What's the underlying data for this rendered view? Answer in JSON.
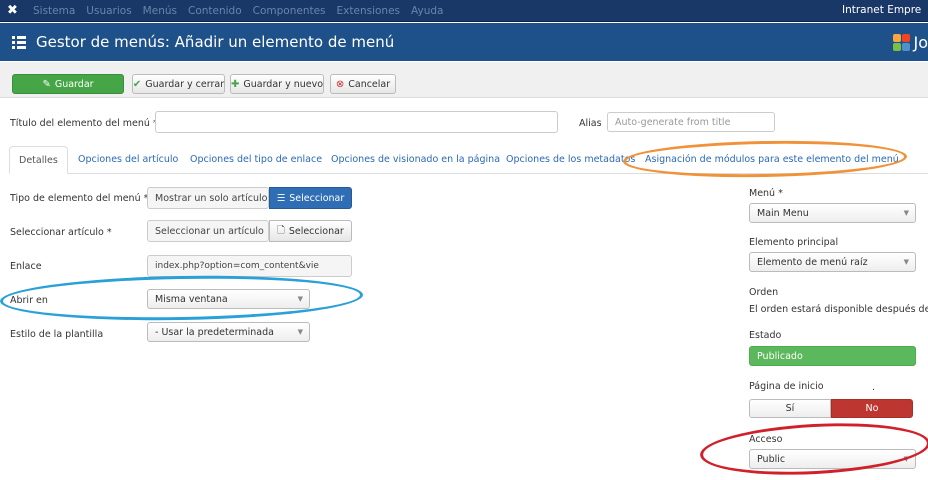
{
  "topnav": {
    "logo_icon": "joomla-x-icon",
    "items": [
      "Sistema",
      "Usuarios",
      "Menús",
      "Contenido",
      "Componentes",
      "Extensiones",
      "Ayuda"
    ],
    "site_name": "Intranet Empre"
  },
  "header": {
    "title": "Gestor de menús: Añadir un elemento de menú",
    "logo_text": "Jo"
  },
  "toolbar": {
    "save": "Guardar",
    "save_close": "Guardar y cerrar",
    "save_new": "Guardar y nuevo",
    "cancel": "Cancelar"
  },
  "title_row": {
    "label": "Título del elemento del menú *",
    "value": "",
    "alias_label": "Alias",
    "alias_placeholder": "Auto-generate from title"
  },
  "tabs": [
    {
      "label": "Detalles",
      "active": true
    },
    {
      "label": "Opciones del artículo"
    },
    {
      "label": "Opciones del tipo de enlace"
    },
    {
      "label": "Opciones de visionado en la página"
    },
    {
      "label": "Opciones de los metadatos"
    },
    {
      "label": "Asignación de módulos para este elemento del menú"
    }
  ],
  "details": {
    "type_label": "Tipo de elemento del menú *",
    "type_value": "Mostrar un solo artículo",
    "type_button": "Seleccionar",
    "article_label": "Seleccionar artículo *",
    "article_value": "Seleccionar un artículo",
    "article_button": "Seleccionar",
    "link_label": "Enlace",
    "link_value": "index.php?option=com_content&vie",
    "open_label": "Abrir en",
    "open_value": "Misma ventana",
    "style_label": "Estilo de la plantilla",
    "style_value": "- Usar la predeterminada"
  },
  "sidebar": {
    "menu_label": "Menú *",
    "menu_value": "Main Menu",
    "parent_label": "Elemento principal",
    "parent_value": "Elemento de menú raíz",
    "order_label": "Orden",
    "order_text": "El orden estará disponible después de gu",
    "status_label": "Estado",
    "status_value": "Publicado",
    "home_label": "Página de inicio",
    "home_dot": ".",
    "home_yes": "Sí",
    "home_no": "No",
    "access_label": "Acceso",
    "access_value": "Public"
  },
  "colors": {
    "topnav_bg": "#1a3867",
    "header_bg": "#1e5189",
    "save_green": "#46a546",
    "status_green": "#5cb85c",
    "no_red": "#bd362f",
    "annotation_orange": "#f0923a",
    "annotation_blue": "#2aa0d8",
    "annotation_red": "#d0202a"
  }
}
